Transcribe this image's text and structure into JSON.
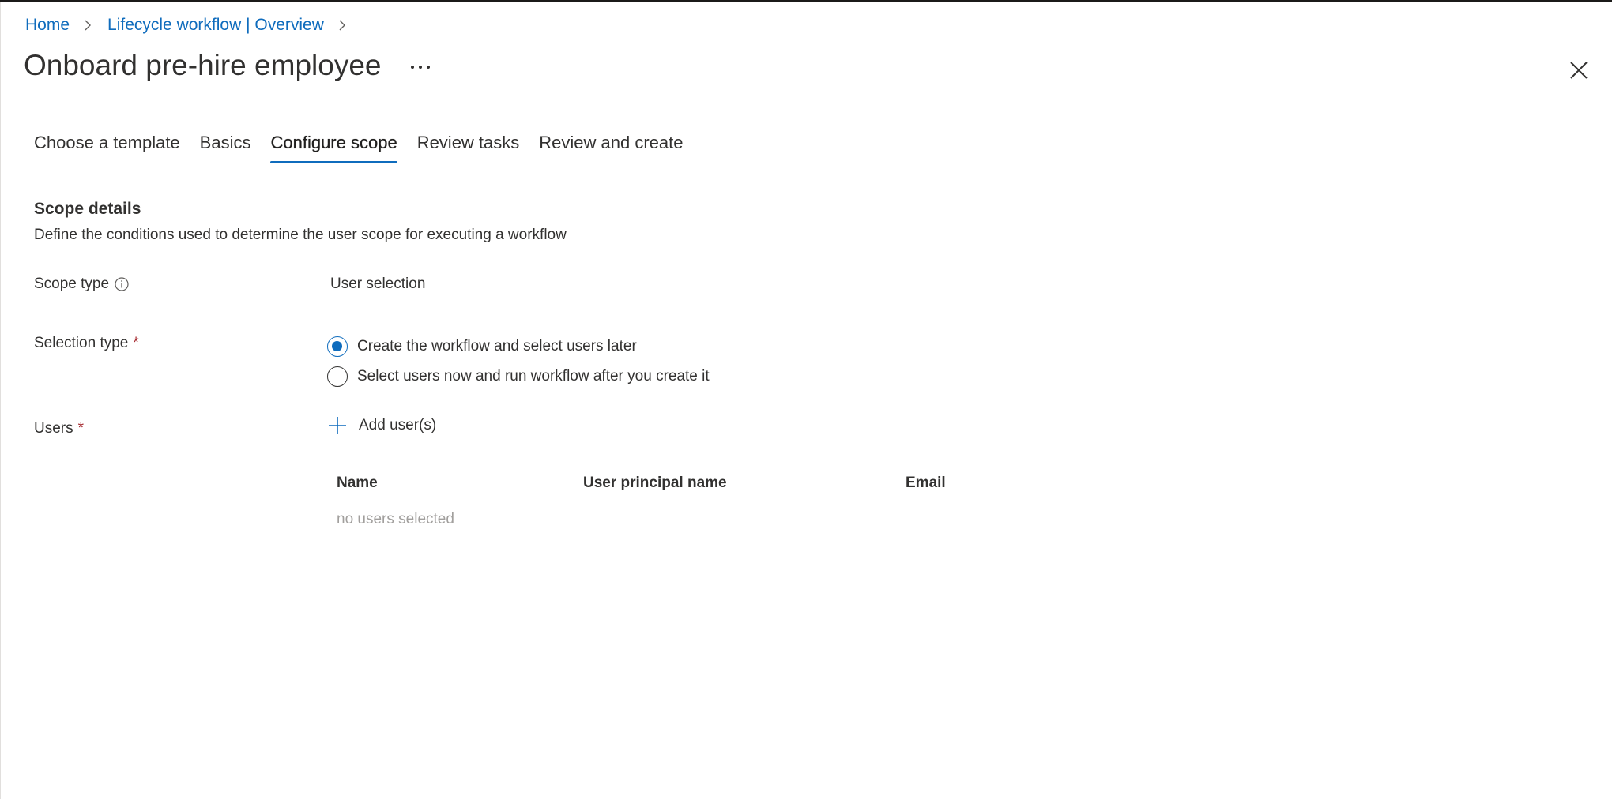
{
  "breadcrumb": {
    "items": [
      {
        "label": "Home"
      },
      {
        "label": "Lifecycle workflow | Overview"
      }
    ]
  },
  "header": {
    "title": "Onboard pre-hire employee",
    "more_icon": "ellipsis-icon",
    "close_icon": "close-icon"
  },
  "tabs": [
    {
      "label": "Choose a template",
      "active": false
    },
    {
      "label": "Basics",
      "active": false
    },
    {
      "label": "Configure scope",
      "active": true
    },
    {
      "label": "Review tasks",
      "active": false
    },
    {
      "label": "Review and create",
      "active": false
    }
  ],
  "scope": {
    "title": "Scope details",
    "description": "Define the conditions used to determine the user scope for executing a workflow",
    "scope_type": {
      "label": "Scope type",
      "value": "User selection"
    },
    "selection_type": {
      "label": "Selection type",
      "required_mark": "*",
      "options": [
        {
          "label": "Create the workflow and select users later",
          "selected": true
        },
        {
          "label": "Select users now and run workflow after you create it",
          "selected": false
        }
      ]
    },
    "users": {
      "label": "Users",
      "required_mark": "*",
      "add_label": "Add user(s)"
    }
  },
  "users_table": {
    "columns": [
      "Name",
      "User principal name",
      "Email"
    ],
    "empty_text": "no users selected"
  },
  "colors": {
    "accent": "#0f6cbd",
    "required": "#a4262c",
    "text": "#323130",
    "muted": "#a19f9d"
  }
}
